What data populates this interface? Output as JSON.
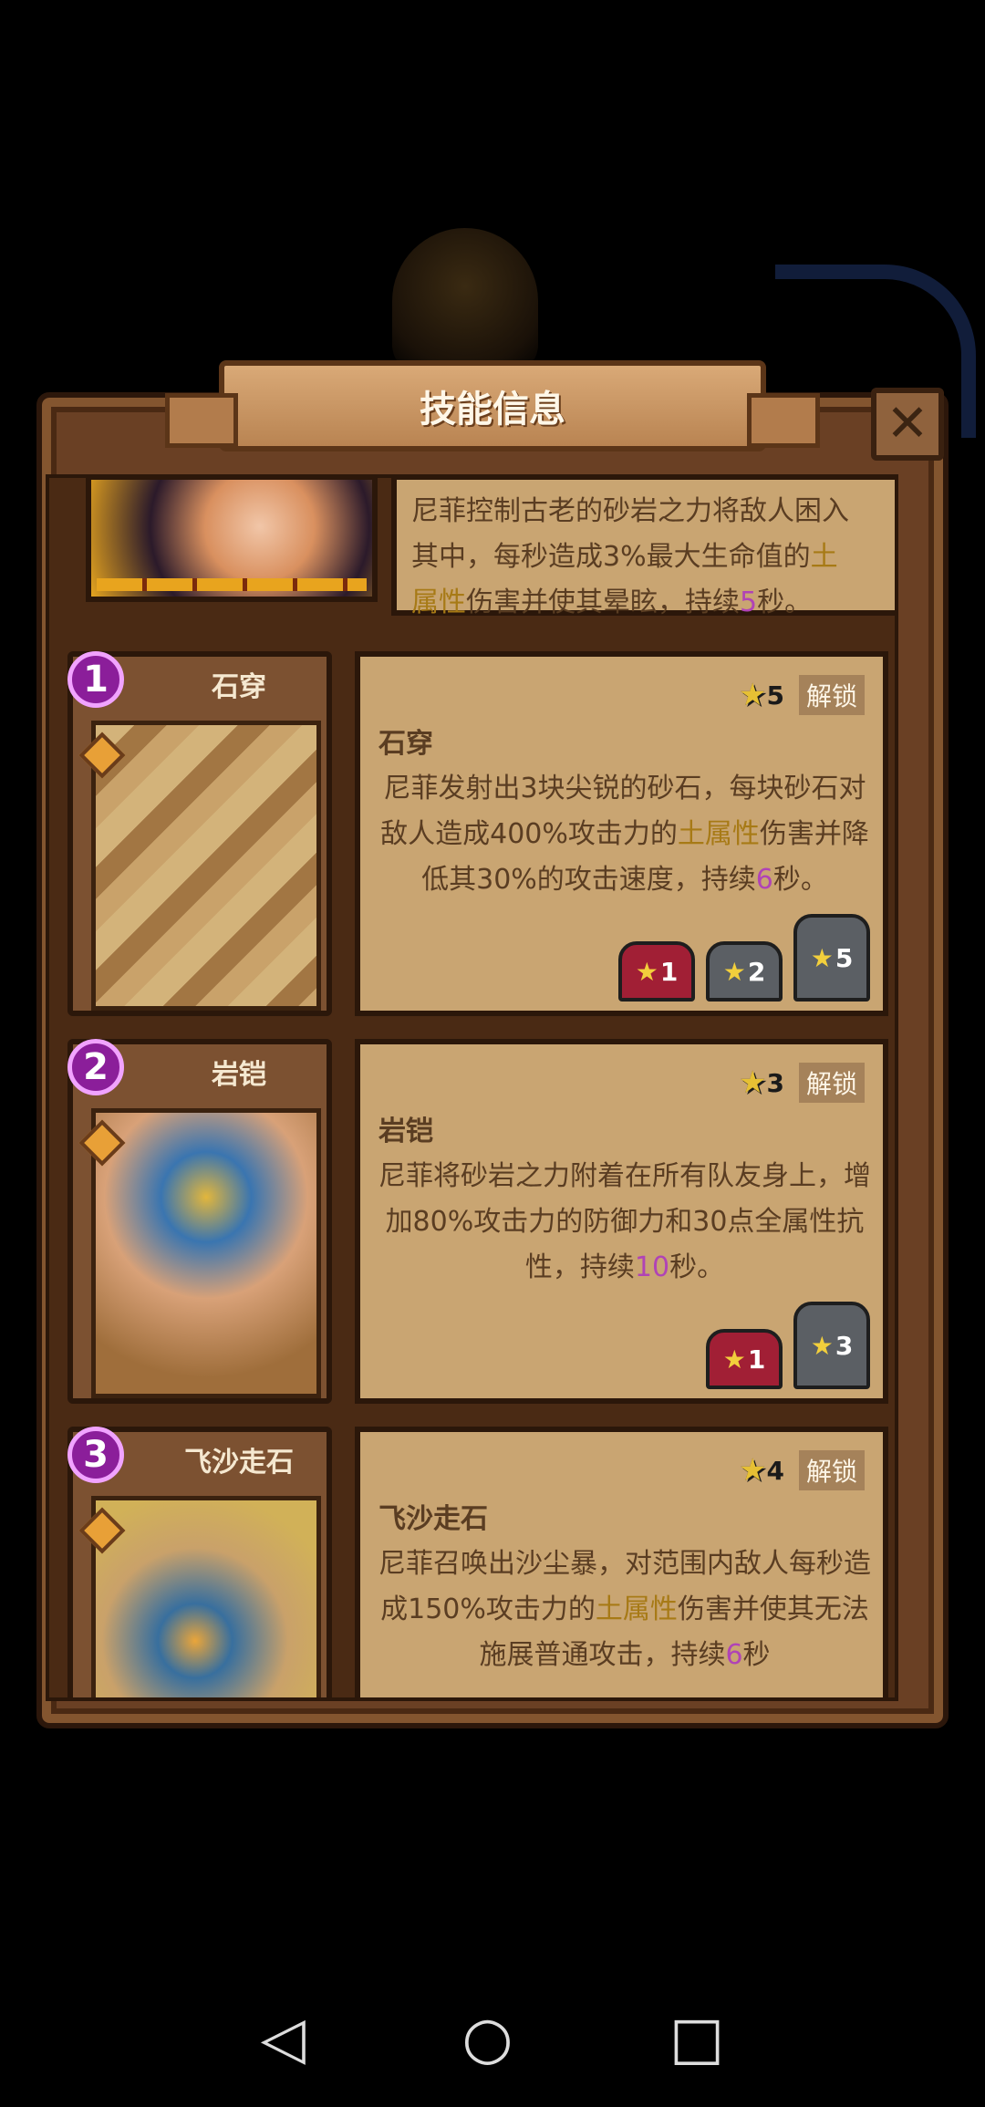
{
  "panel": {
    "title": "技能信息",
    "close_symbol": "✕"
  },
  "top_skill": {
    "desc_lines": [
      "尼菲控制古老的砂岩之力将敌人困入",
      "其中，每秒造成3%最大生命值的",
      "土",
      "属性",
      "伤害并使其晕眩，持续",
      "5",
      "秒。"
    ]
  },
  "skills": [
    {
      "number": "1",
      "name": "石穿",
      "star_req": "5",
      "unlock_label": "解锁",
      "title": "石穿",
      "desc": {
        "p1": "尼菲发射出3块尖锐的砂石，每块砂石对敌人造成400%攻击力的",
        "p2": "土属性",
        "p3": "伤害并降低其30%的攻击速度，持续",
        "p4": "6",
        "p5": "秒。"
      },
      "levels": [
        "1",
        "2",
        "5"
      ]
    },
    {
      "number": "2",
      "name": "岩铠",
      "star_req": "3",
      "unlock_label": "解锁",
      "title": "岩铠",
      "desc": {
        "p1": "尼菲将砂岩之力附着在所有队友身上，增加80%攻击力的防御力和30点全属性抗性，持续",
        "p2": "10",
        "p3": "秒。"
      },
      "levels": [
        "1",
        "3"
      ]
    },
    {
      "number": "3",
      "name": "飞沙走石",
      "star_req": "4",
      "unlock_label": "解锁",
      "title": "飞沙走石",
      "desc": {
        "p1": "尼菲召唤出沙尘暴，对范围内敌人每秒造成150%攻击力的",
        "p2": "土属性",
        "p3": "伤害并使其无法施展普通攻击，持续",
        "p4": "6",
        "p5": "秒"
      }
    }
  ],
  "nav": {
    "back": "◁",
    "home": "○",
    "recents": "□"
  }
}
